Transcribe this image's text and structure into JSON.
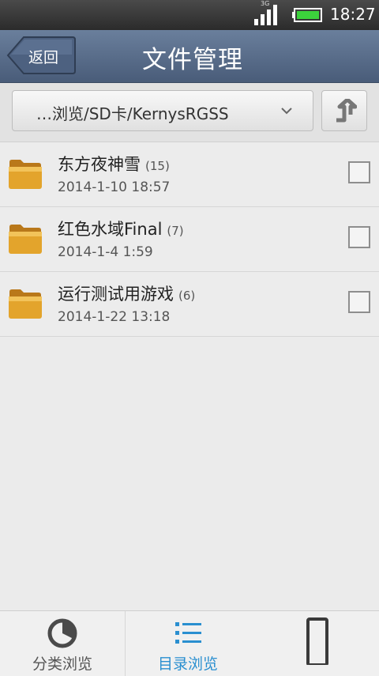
{
  "status": {
    "network": "3G",
    "time": "18:27"
  },
  "header": {
    "back_label": "返回",
    "title": "文件管理"
  },
  "path": {
    "current": "…浏览/SD卡/KernysRGSS"
  },
  "files": [
    {
      "name": "东方夜神雪",
      "count": "(15)",
      "date": "2014-1-10 18:57"
    },
    {
      "name": "红色水域Final",
      "count": "(7)",
      "date": "2014-1-4 1:59"
    },
    {
      "name": "运行测试用游戏",
      "count": "(6)",
      "date": "2014-1-22 13:18"
    }
  ],
  "bottom_nav": {
    "tabs": [
      {
        "label": "分类浏览",
        "icon": "pie-chart-icon"
      },
      {
        "label": "目录浏览",
        "icon": "list-icon",
        "active": true
      },
      {
        "label": "",
        "icon": "phone-icon"
      }
    ]
  },
  "colors": {
    "title_bar": "#5a6e8b",
    "active_tab": "#2a8fd0",
    "folder": "#e0a12a"
  }
}
